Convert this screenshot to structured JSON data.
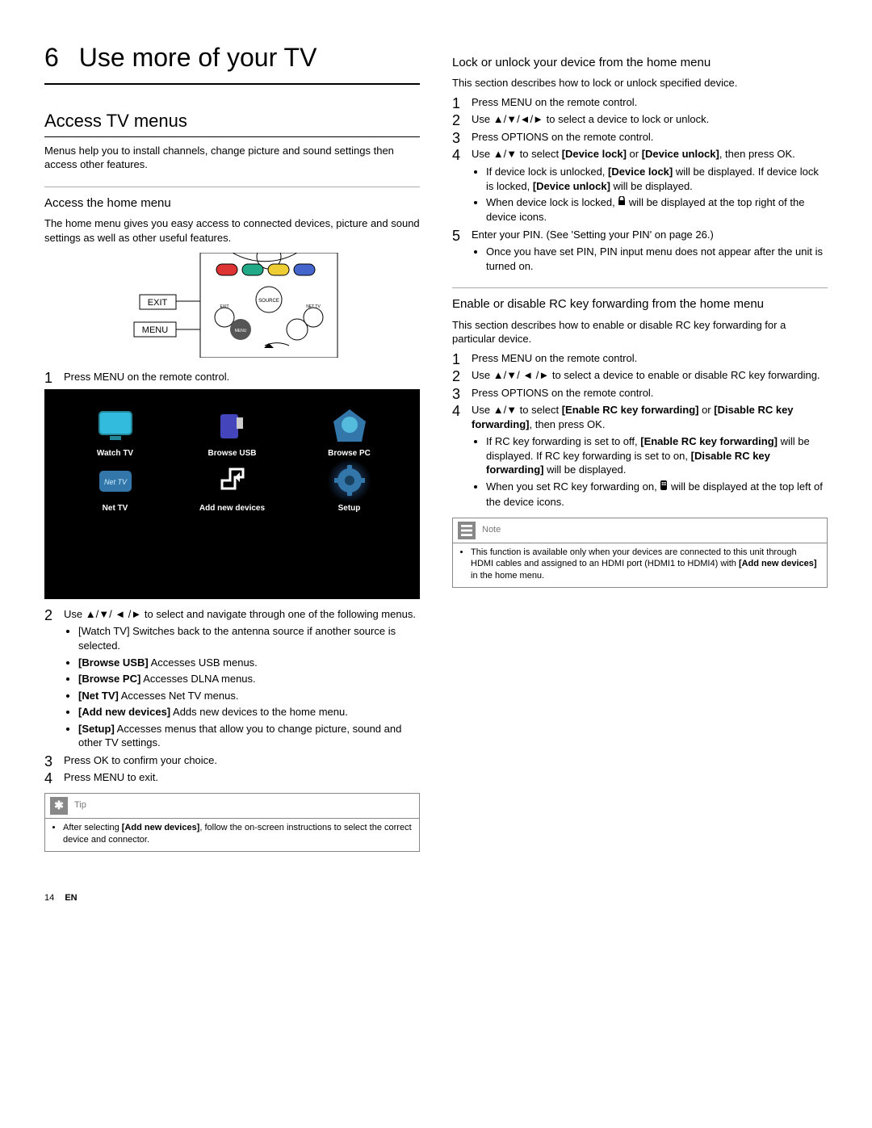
{
  "page": {
    "number": "14",
    "lang": "EN"
  },
  "chapter": {
    "number": "6",
    "title": "Use more of your TV"
  },
  "col1": {
    "section_title": "Access TV menus",
    "intro": "Menus help you to install channels, change picture and sound settings then access other features.",
    "access_home": {
      "title": "Access the home menu",
      "desc": "The home menu gives you easy access to connected devices, picture and sound settings as well as other useful features.",
      "remote": {
        "exit_label": "EXIT",
        "menu_label": "MENU",
        "source_label": "SOURCE",
        "nettv_label": "NET TV",
        "small_exit": "EXIT",
        "small_menu": "MENU"
      },
      "step1": "Press MENU on the remote control.",
      "home_menu_items": {
        "watch_tv": "Watch TV",
        "browse_usb": "Browse USB",
        "browse_pc": "Browse PC",
        "net_tv": "Net TV",
        "add_new": "Add new devices",
        "setup": "Setup"
      },
      "step2_lead": "Use ▲/▼/ ◄ /► to select and navigate through one of the following menus.",
      "step2_items": {
        "watch": "[Watch TV] Switches back to the antenna source if another source is selected.",
        "browse_usb_bold": "[Browse USB]",
        "browse_usb_rest": " Accesses USB menus.",
        "browse_pc_bold": "[Browse PC]",
        "browse_pc_rest": " Accesses DLNA menus.",
        "nettv_bold": "[Net TV]",
        "nettv_rest": " Accesses Net TV menus.",
        "add_bold": "[Add new devices]",
        "add_rest": " Adds new devices to the home menu.",
        "setup_bold": "[Setup]",
        "setup_rest": " Accesses menus that allow you to change picture, sound and other TV settings."
      },
      "step3": "Press OK to confirm your choice.",
      "step4": "Press MENU to exit.",
      "tip": {
        "label": "Tip",
        "text_a": "After selecting ",
        "text_bold": "[Add new devices]",
        "text_b": ", follow the on-screen instructions to select the correct device and connector."
      }
    }
  },
  "col2": {
    "lock": {
      "title": "Lock or unlock your device from the home menu",
      "desc": "This section describes how to lock or unlock specified device.",
      "step1": "Press MENU on the remote control.",
      "step2": "Use ▲/▼/◄/► to select a device to lock or unlock.",
      "step3": "Press OPTIONS on the remote control.",
      "step4_a": "Use ▲/▼ to select ",
      "step4_b1": "[Device lock]",
      "step4_or": " or ",
      "step4_b2": "[Device unlock]",
      "step4_c": ", then press OK.",
      "step4_sub1_a": "If device lock is unlocked, ",
      "step4_sub1_b": "[Device lock]",
      "step4_sub1_c": " will be displayed. If device lock is locked, ",
      "step4_sub1_d": "[Device unlock]",
      "step4_sub1_e": " will be displayed.",
      "step4_sub2_a": "When device lock is locked, ",
      "step4_sub2_b": " will be displayed at the top right of the device icons.",
      "step5": "Enter your PIN. (See 'Setting your PIN' on page 26.)",
      "step5_sub1": "Once you have set PIN, PIN input menu does not appear after the unit is turned on."
    },
    "rc": {
      "title": "Enable or disable RC key forwarding from the home menu",
      "desc": "This section describes how to enable or disable RC key forwarding for a particular device.",
      "step1": "Press MENU on the remote control.",
      "step2": "Use ▲/▼/ ◄ /► to select a device to enable or disable RC key forwarding.",
      "step3": "Press OPTIONS on the remote control.",
      "step4_a": "Use ▲/▼ to select ",
      "step4_b1": "[Enable RC key forwarding]",
      "step4_or": " or ",
      "step4_b2": "[Disable RC key forwarding]",
      "step4_c": ", then press OK.",
      "step4_sub1_a": "If RC key forwarding is set to off, ",
      "step4_sub1_b": "[Enable RC key forwarding]",
      "step4_sub1_c": " will be displayed. If RC key forwarding is set to on, ",
      "step4_sub1_d": "[Disable RC key forwarding]",
      "step4_sub1_e": " will be displayed.",
      "step4_sub2_a": "When you set RC key forwarding on, ",
      "step4_sub2_b": " will be displayed at the top left of the device icons.",
      "note": {
        "label": "Note",
        "text_a": "This function is available only when your devices are connected to this unit through HDMI cables and assigned to an HDMI port (HDMI1 to HDMI4) with ",
        "text_b": "[Add new devices]",
        "text_c": " in the home menu."
      }
    }
  }
}
